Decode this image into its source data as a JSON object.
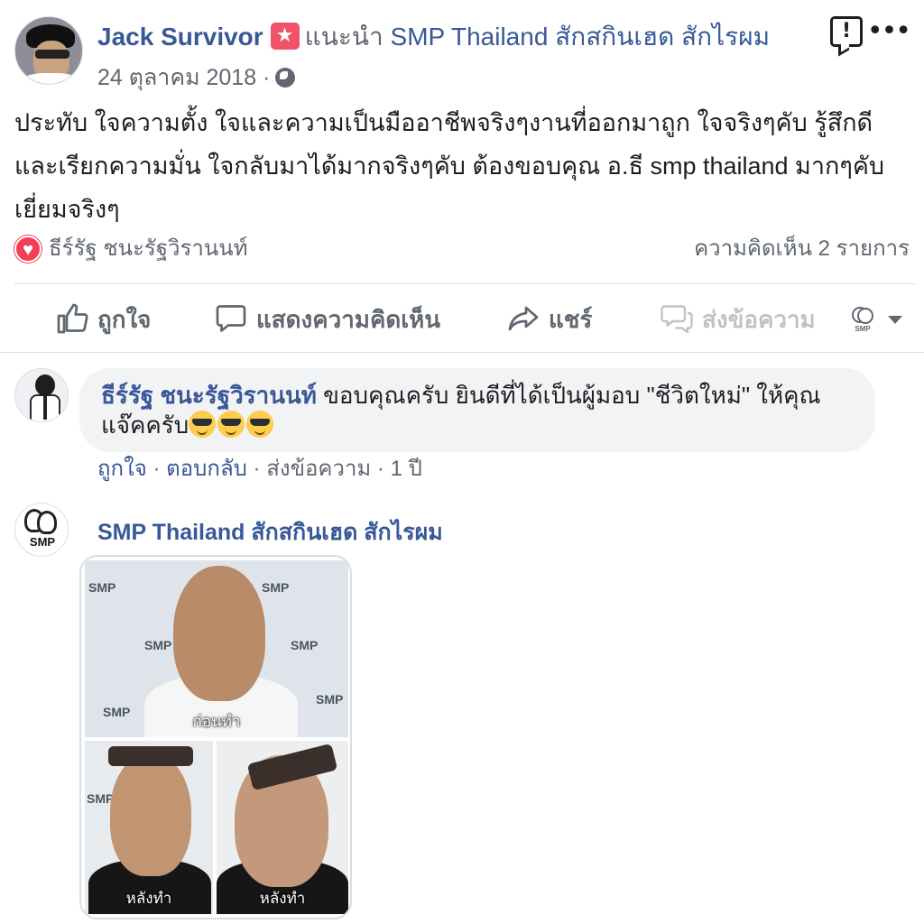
{
  "post": {
    "author": "Jack Survivor",
    "recommends_verb": "แนะนำ",
    "recommended_page": "SMP Thailand สักสกินเฮด สักไรผม",
    "date": "24 ตุลาคม 2018",
    "separator": "·",
    "audience_icon": "globe-icon",
    "text": "ประทับ ใจความตั้ง ใจและความเป็นมืออาชีพจริงๆงานที่ออกมาถูก ใจจริงๆคับ รู้สึกดีและเรียกความมั่น ใจกลับมาได้มากจริงๆคับ ต้องขอบคุณ อ.ธี smp thailand มากๆคับเยี่ยมจริงๆ"
  },
  "reactions": {
    "icon": "heart-icon",
    "reactor": "ธีร์รัฐ ชนะรัฐวิรานนท์",
    "comment_count": "ความคิดเห็น 2 รายการ"
  },
  "actions": {
    "like": "ถูกใจ",
    "comment": "แสดงความคิดเห็น",
    "share": "แชร์",
    "message": "ส่งข้อความ"
  },
  "comment": {
    "author": "ธีร์รัฐ ชนะรัฐวิรานนท์",
    "text": "ขอบคุณครับ ยินดีที่ได้เป็นผู้มอบ \"ชีวิตใหม่\" ให้คุณแจ๊คครับ",
    "emoji": "smiling-face-with-sunglasses",
    "like": "ถูกใจ",
    "reply": "ตอบกลับ",
    "message": "ส่งข้อความ",
    "sep": " · ",
    "time": "1 ปี"
  },
  "attachment": {
    "page_name": "SMP Thailand สักสกินเฮด สักไรผม",
    "page_logo": "SMP",
    "watermark": "SMP",
    "caption_before": "ก่อนทำ",
    "caption_after_1": "หลังทำ",
    "caption_after_2": "หลังทำ"
  },
  "colors": {
    "link": "#385898",
    "secondary_text": "#606770",
    "recommend_badge": "#f25268",
    "love": "#f33e58",
    "bubble": "#f2f3f5"
  }
}
